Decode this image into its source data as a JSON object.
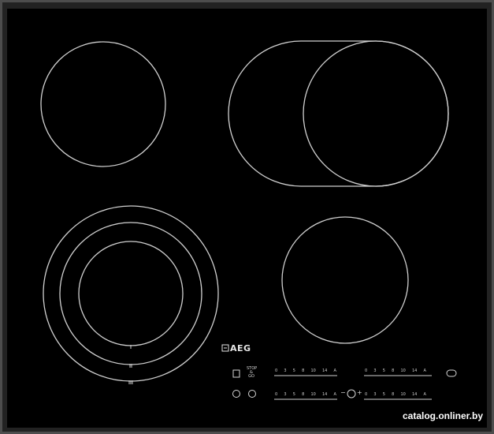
{
  "image": {
    "description_color": "#000000",
    "frame_color": "#4a4a4a",
    "ring_color": "#c9c9c9"
  },
  "brand": {
    "text": "AEG",
    "icon": "aeg-logo-icon"
  },
  "controls": {
    "stop_go_label": "STOP\n&\nGO",
    "power_icon": "power-icon",
    "lock_icon": "lock-icon",
    "timer_minus": "−",
    "timer_plus": "+",
    "timer_icon": "timer-icon",
    "bridge_icon": "bridge-zone-icon",
    "keep_warm_icon": "keep-warm-icon"
  },
  "scales": [
    {
      "ticks": [
        "0",
        "3",
        "5",
        "8",
        "10",
        "14"
      ],
      "suffix": "A"
    },
    {
      "ticks": [
        "0",
        "3",
        "5",
        "8",
        "10",
        "14"
      ],
      "suffix": "A"
    },
    {
      "ticks": [
        "0",
        "3",
        "5",
        "8",
        "10",
        "14"
      ],
      "suffix": "A"
    },
    {
      "ticks": [
        "0",
        "3",
        "5",
        "8",
        "10",
        "14"
      ],
      "suffix": "A"
    }
  ],
  "watermark": "catalog.onliner.by"
}
